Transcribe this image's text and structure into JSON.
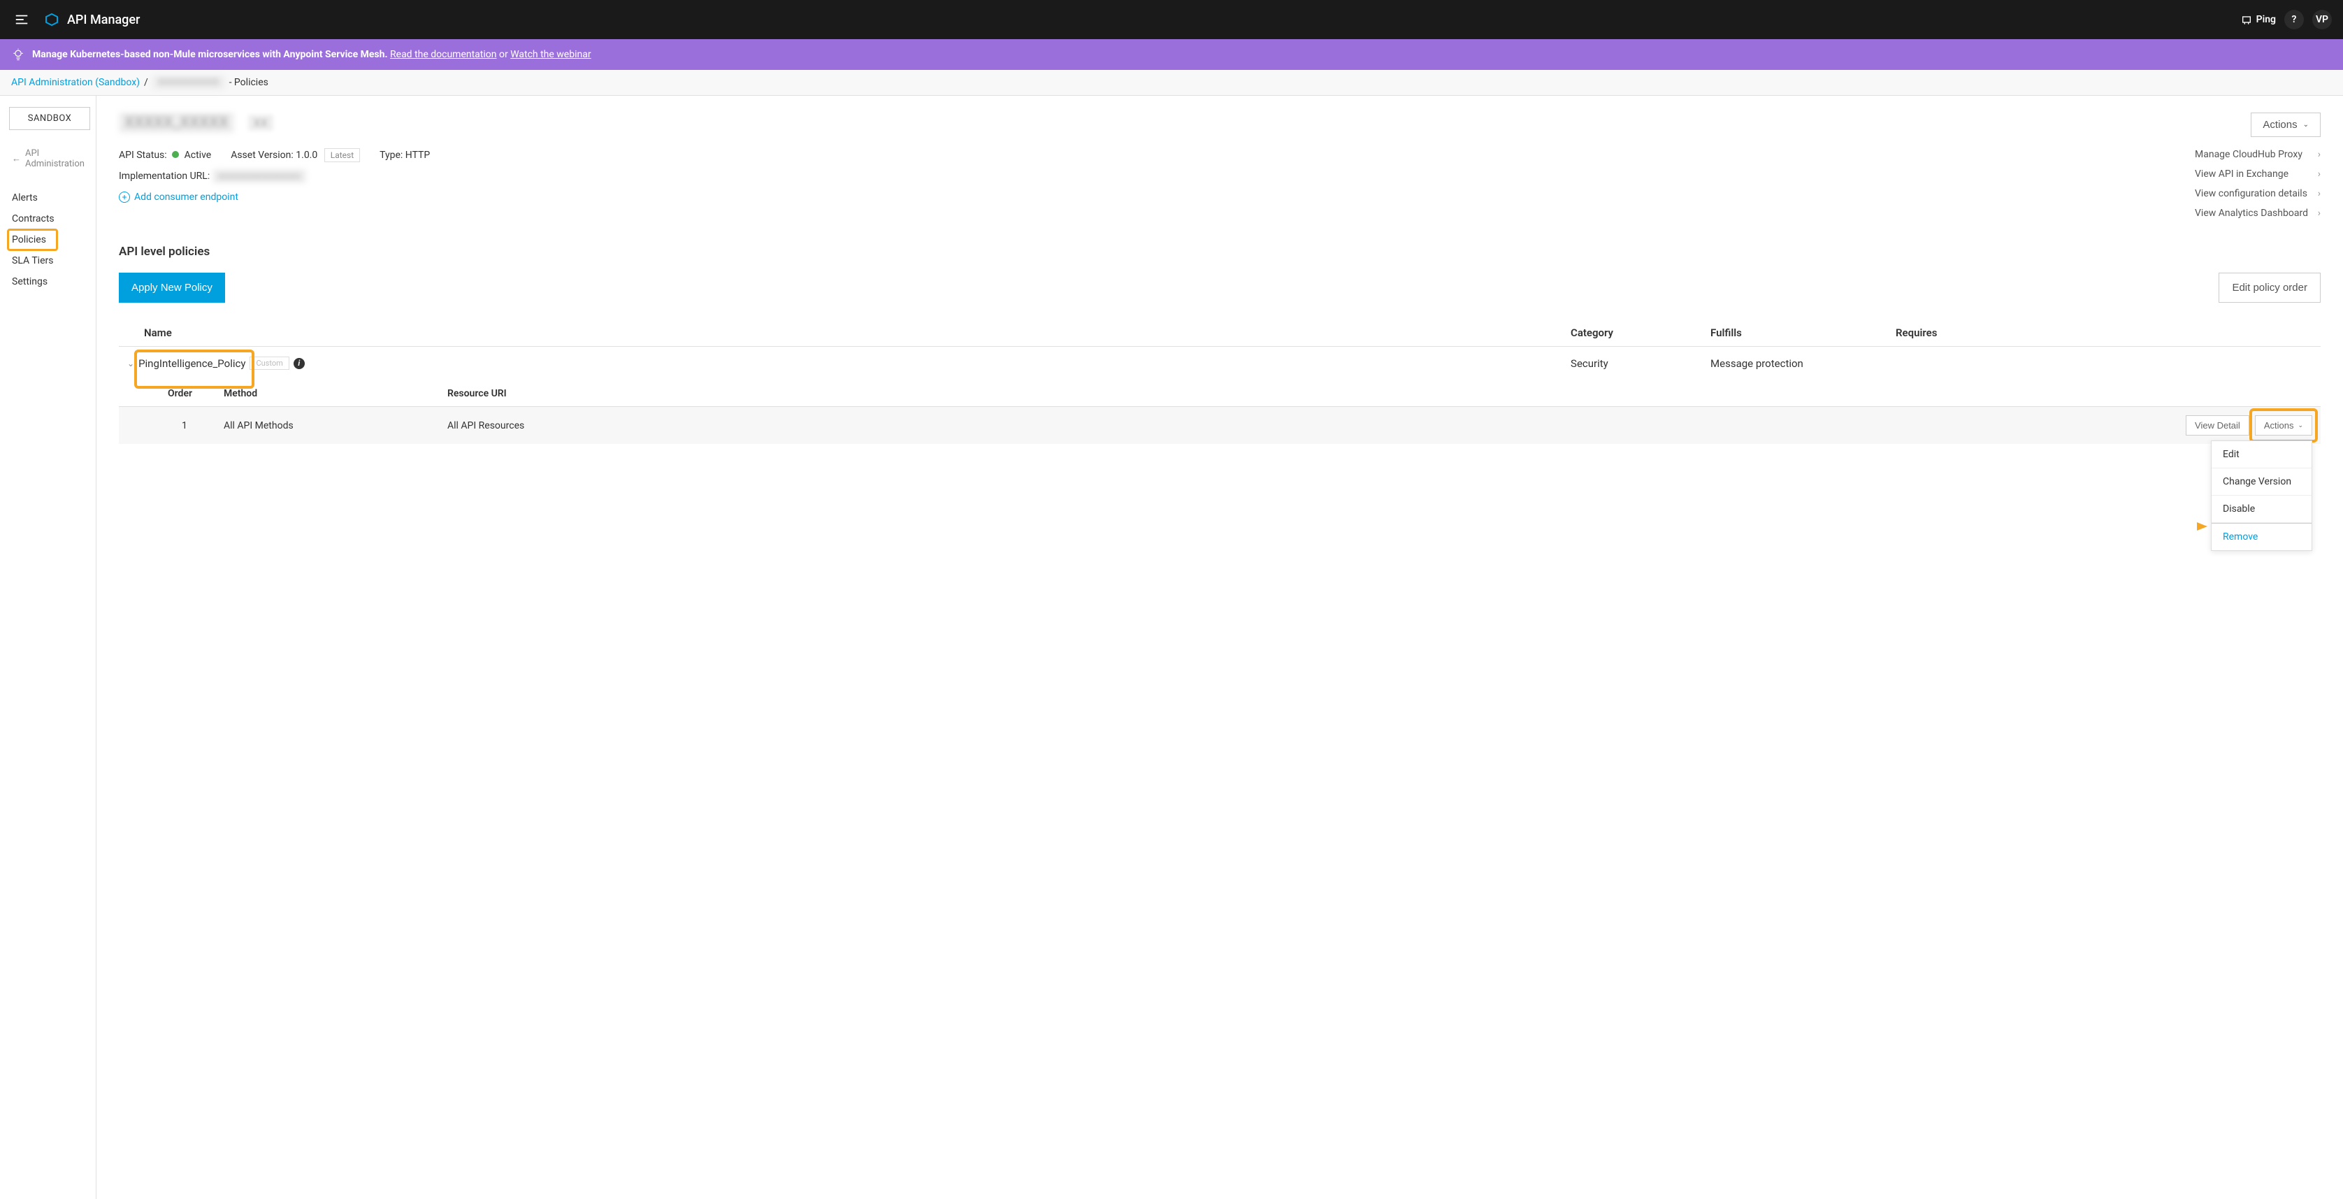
{
  "topbar": {
    "app_title": "API Manager",
    "brand_label": "Ping",
    "help_label": "?",
    "user_initials": "VP"
  },
  "banner": {
    "bold_text": "Manage Kubernetes-based non-Mule microservices with Anypoint Service Mesh.",
    "link1": "Read the documentation",
    "between": " or ",
    "link2": "Watch the webinar"
  },
  "breadcrumb": {
    "link1": "API Administration (Sandbox)",
    "middle": " ",
    "tail": " - Policies"
  },
  "sidebar": {
    "env": "SANDBOX",
    "back": "API Administration",
    "items": [
      {
        "label": "Alerts"
      },
      {
        "label": "Contracts"
      },
      {
        "label": "Policies"
      },
      {
        "label": "SLA Tiers"
      },
      {
        "label": "Settings"
      }
    ]
  },
  "header": {
    "actions_btn": "Actions",
    "status_label": "API Status:",
    "status_value": "Active",
    "asset_version_label": "Asset Version: 1.0.0",
    "latest_tag": "Latest",
    "type_label": "Type: HTTP",
    "impl_label": "Implementation URL:",
    "add_endpoint": "Add consumer endpoint"
  },
  "quick_links": [
    {
      "label": "Manage CloudHub Proxy"
    },
    {
      "label": "View API in Exchange"
    },
    {
      "label": "View configuration details"
    },
    {
      "label": "View Analytics Dashboard"
    }
  ],
  "section": {
    "title": "API level policies",
    "apply_btn": "Apply New Policy",
    "edit_order_btn": "Edit policy order"
  },
  "table": {
    "cols": {
      "name": "Name",
      "category": "Category",
      "fulfills": "Fulfills",
      "requires": "Requires"
    },
    "rows": [
      {
        "name": "PingIntelligence_Policy",
        "custom_tag": "Custom",
        "category": "Security",
        "fulfills": "Message protection",
        "requires": ""
      }
    ],
    "sub": {
      "cols": {
        "order": "Order",
        "method": "Method",
        "uri": "Resource URI"
      },
      "rows": [
        {
          "order": "1",
          "method": "All API Methods",
          "uri": "All API Resources"
        }
      ],
      "view_detail": "View Detail",
      "actions": "Actions"
    }
  },
  "dropdown": {
    "items": [
      {
        "label": "Edit"
      },
      {
        "label": "Change Version"
      },
      {
        "label": "Disable"
      },
      {
        "label": "Remove",
        "highlight": true
      }
    ]
  }
}
